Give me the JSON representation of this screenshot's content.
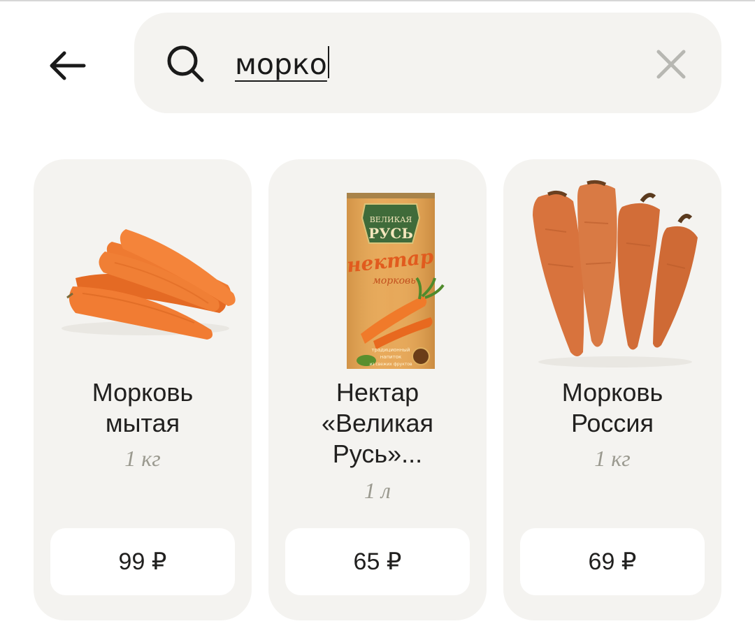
{
  "search": {
    "query": "морко"
  },
  "products": [
    {
      "title_line1": "Морковь",
      "title_line2": "мытая",
      "title_line3": "",
      "unit": "1 кг",
      "price": "99 ₽"
    },
    {
      "title_line1": "Нектар",
      "title_line2": "«Великая",
      "title_line3": "Русь»...",
      "unit": "1 л",
      "price": "65 ₽",
      "package": {
        "brand_line1": "ВЕЛИКАЯ",
        "brand_line2": "РУСЬ",
        "product": "нектар",
        "flavor": "морковь",
        "tagline1": "традиционный",
        "tagline2": "напиток",
        "tagline3": "из свежих фруктов"
      }
    },
    {
      "title_line1": "Морковь",
      "title_line2": "Россия",
      "title_line3": "",
      "unit": "1 кг",
      "price": "69 ₽"
    }
  ],
  "colors": {
    "card_background": "#f4f3f0",
    "unit_text": "#9a998f",
    "carrot_orange": "#f07a30",
    "carrot_unwashed": "#d8733d"
  },
  "icons": {
    "back": "arrow-left-icon",
    "search": "magnifier-icon",
    "clear": "close-icon"
  }
}
